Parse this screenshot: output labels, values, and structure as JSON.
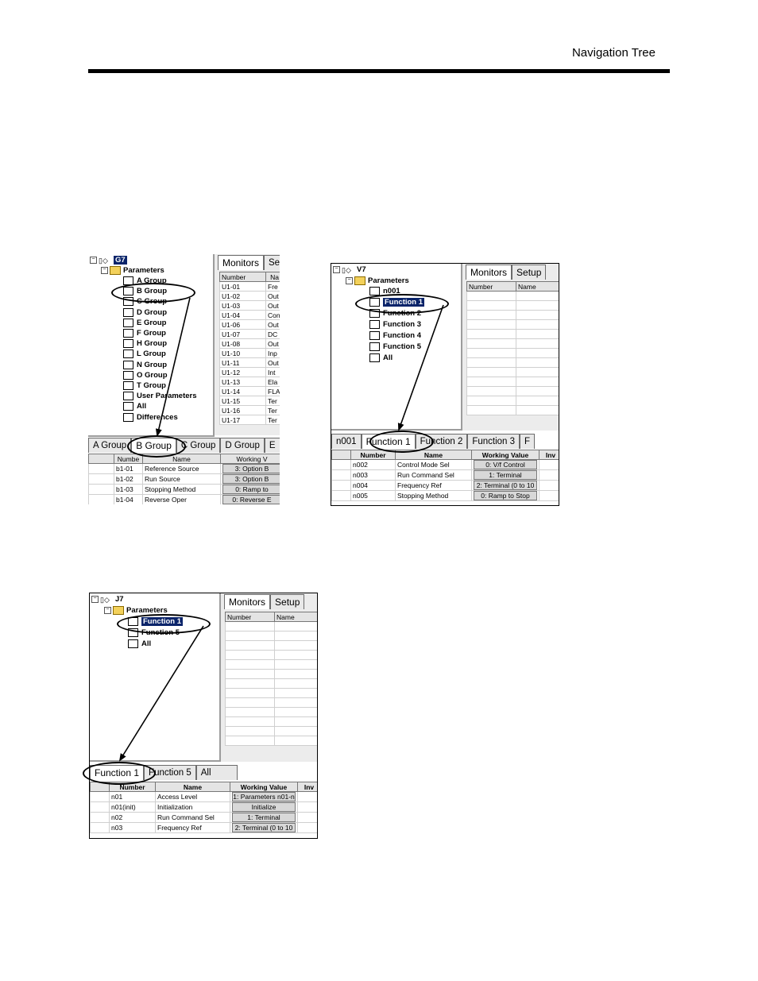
{
  "header": {
    "title": "Navigation Tree"
  },
  "g7": {
    "root": "G7",
    "parameters": "Parameters",
    "groups": [
      "A Group",
      "B Group",
      "C Group",
      "D Group",
      "E Group",
      "F Group",
      "H Group",
      "L Group",
      "N Group",
      "O Group",
      "T Group",
      "User Parameters",
      "All",
      "Differences"
    ],
    "right_tabs": [
      "Monitors",
      "Se"
    ],
    "monitor_cols": [
      "Number",
      "Na"
    ],
    "monitor_rows": [
      [
        "U1-01",
        "Fre"
      ],
      [
        "U1-02",
        "Out"
      ],
      [
        "U1-03",
        "Out"
      ],
      [
        "U1-04",
        "Con"
      ],
      [
        "U1-06",
        "Out"
      ],
      [
        "U1-07",
        "DC"
      ],
      [
        "U1-08",
        "Out"
      ],
      [
        "U1-10",
        "Inp"
      ],
      [
        "U1-11",
        "Out"
      ],
      [
        "U1-12",
        "Int"
      ],
      [
        "U1-13",
        "Ela"
      ],
      [
        "U1-14",
        "FLA"
      ],
      [
        "U1-15",
        "Ter"
      ],
      [
        "U1-16",
        "Ter"
      ],
      [
        "U1-17",
        "Ter"
      ]
    ],
    "bottom_tabs": [
      "A Group",
      "B Group",
      "C Group",
      "D Group",
      "E"
    ],
    "param_cols": [
      "Numbe",
      "Name",
      "Working V"
    ],
    "param_rows": [
      [
        "b1-01",
        "Reference Source",
        "3: Option B"
      ],
      [
        "b1-02",
        "Run Source",
        "3: Option B"
      ],
      [
        "b1-03",
        "Stopping Method",
        "0: Ramp to"
      ],
      [
        "b1-04",
        "Reverse Oper",
        "0: Reverse E"
      ]
    ]
  },
  "v7": {
    "root": "V7",
    "parameters": "Parameters",
    "items": [
      "n001",
      "Function 1",
      "Function 2",
      "Function 3",
      "Function 4",
      "Function 5",
      "All"
    ],
    "right_tabs": [
      "Monitors",
      "Setup"
    ],
    "monitor_cols": [
      "Number",
      "Name"
    ],
    "bottom_tabs": [
      "n001",
      "Function 1",
      "Function 2",
      "Function 3",
      "F"
    ],
    "param_cols": [
      "Number",
      "Name",
      "Working Value",
      "Inv"
    ],
    "param_rows": [
      [
        "n002",
        "Control Mode Sel",
        "0: V/f Control"
      ],
      [
        "n003",
        "Run Command Sel",
        "1: Terminal"
      ],
      [
        "n004",
        "Frequency Ref",
        "2: Terminal (0 to 10"
      ],
      [
        "n005",
        "Stopping Method",
        "0: Ramp to Stop"
      ]
    ]
  },
  "j7": {
    "root": "J7",
    "parameters": "Parameters",
    "items": [
      "Function 1",
      "Function 5",
      "All"
    ],
    "right_tabs": [
      "Monitors",
      "Setup"
    ],
    "monitor_cols": [
      "Number",
      "Name"
    ],
    "bottom_tabs": [
      "Function 1",
      "Function 5",
      "All"
    ],
    "param_cols": [
      "Number",
      "Name",
      "Working Value",
      "Inv"
    ],
    "param_rows": [
      [
        "n01",
        "Access Level",
        "1: Parameters n01-n"
      ],
      [
        "n01(init)",
        "Initialization",
        "Initialize"
      ],
      [
        "n02",
        "Run Command Sel",
        "1: Terminal"
      ],
      [
        "n03",
        "Frequency Ref",
        "2: Terminal (0 to 10"
      ]
    ]
  }
}
